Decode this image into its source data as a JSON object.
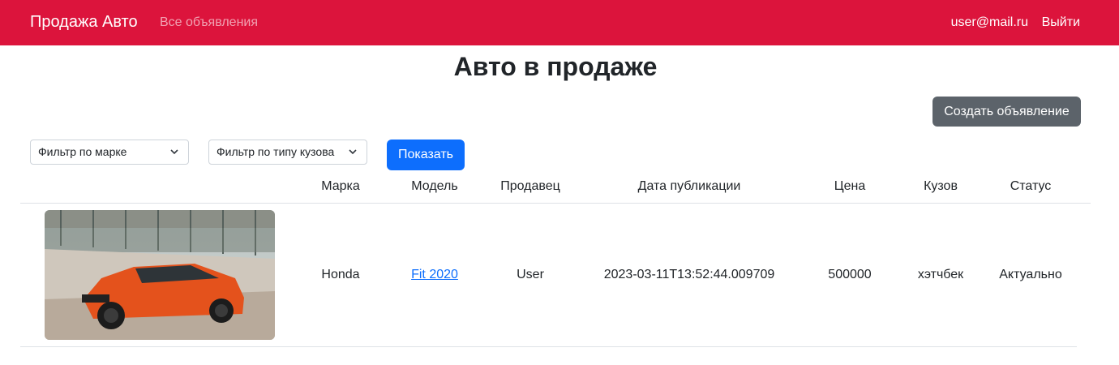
{
  "navbar": {
    "brand": "Продажа Авто",
    "all_ads": "Все объявления",
    "user": "user@mail.ru",
    "logout": "Выйти",
    "color": "#dc143c"
  },
  "page": {
    "title": "Авто в продаже",
    "create_button": "Создать объявление"
  },
  "filters": {
    "brand_select": "Фильтр по марке",
    "body_select": "Фильтр по типу кузова",
    "show_button": "Показать"
  },
  "table": {
    "headers": [
      "Марка",
      "Модель",
      "Продавец",
      "Дата публикации",
      "Цена",
      "Кузов",
      "Статус"
    ],
    "rows": [
      {
        "brand": "Honda",
        "model": "Fit 2020",
        "seller": "User",
        "date": "2023-03-11T13:52:44.009709",
        "price": "500000",
        "body": "хэтчбек",
        "status": "Актуально"
      }
    ]
  }
}
